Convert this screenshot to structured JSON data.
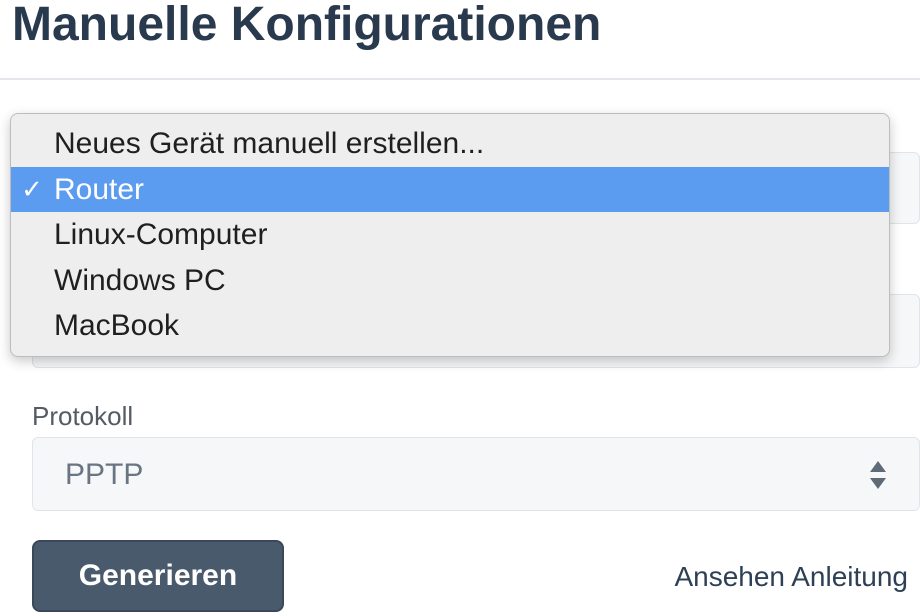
{
  "header": {
    "title": "Manuelle Konfigurationen"
  },
  "device_dropdown": {
    "items": [
      {
        "label": "Neues Gerät manuell erstellen...",
        "selected": false
      },
      {
        "label": "Router",
        "selected": true
      },
      {
        "label": "Linux-Computer",
        "selected": false
      },
      {
        "label": "Windows PC",
        "selected": false
      },
      {
        "label": "MacBook",
        "selected": false
      }
    ],
    "check_glyph": "✓",
    "highlight_color": "#5b9bf0"
  },
  "protocol": {
    "label": "Protokoll",
    "value": "PPTP",
    "arrow_icon": "updown-arrows-icon"
  },
  "actions": {
    "generate_label": "Generieren",
    "guide_link_label": "Ansehen Anleitung"
  },
  "colors": {
    "title": "#2a3a4e",
    "button_bg": "#4a5a6d",
    "link": "#2e4056"
  }
}
